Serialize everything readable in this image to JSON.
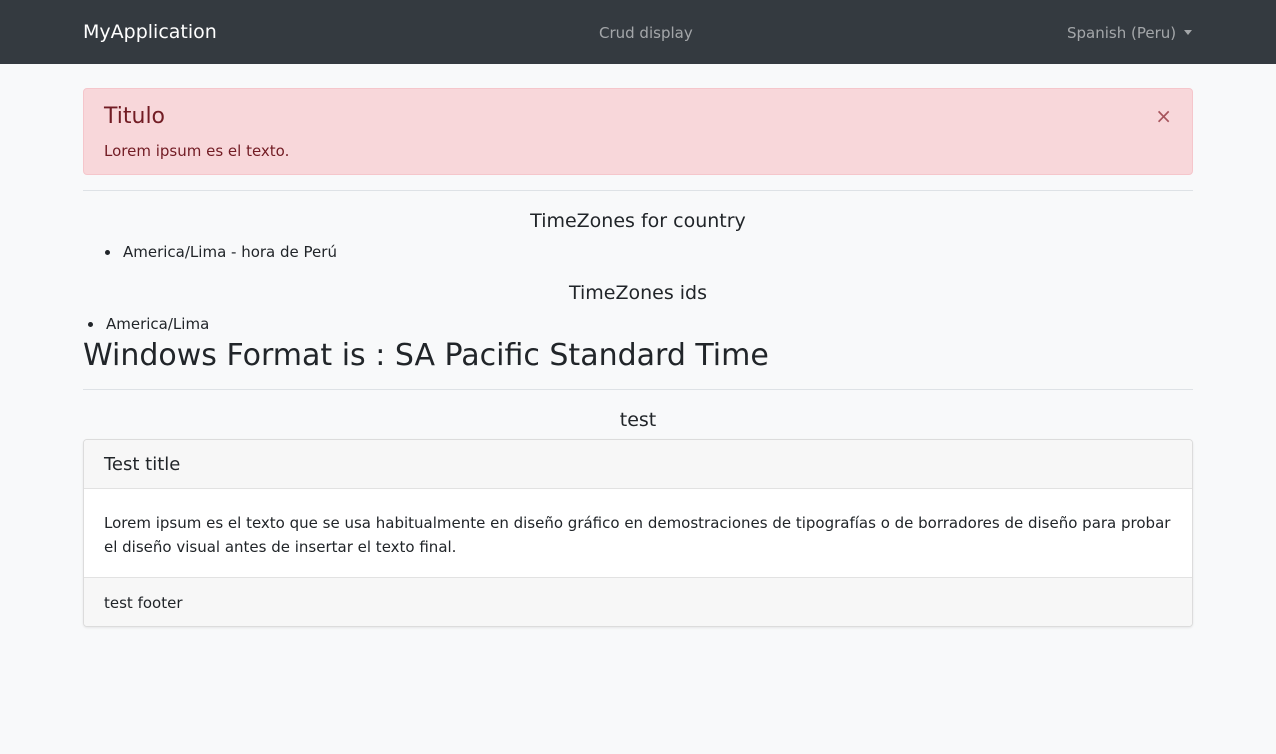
{
  "navbar": {
    "brand": "MyApplication",
    "link": "Crud display",
    "language": "Spanish (Peru)"
  },
  "alert": {
    "title": "Titulo",
    "text": "Lorem ipsum es el texto.",
    "close": "×"
  },
  "timezones_country": {
    "title": "TimeZones for country",
    "items": [
      "America/Lima - hora de Perú"
    ]
  },
  "timezones_ids": {
    "title": "TimeZones ids",
    "items": [
      "America/Lima"
    ]
  },
  "windows_format": "Windows Format is : SA Pacific Standard Time",
  "test_section": {
    "title": "test"
  },
  "card": {
    "header": "Test title",
    "body": "Lorem ipsum es el texto que se usa habitualmente en diseño gráfico en demostraciones de tipografías o de borradores de diseño para probar el diseño visual antes de insertar el texto final.",
    "footer": "test footer"
  },
  "colors": {
    "navbar_bg": "#343a40",
    "page_bg": "#f8f9fa",
    "alert_bg": "#f8d7da",
    "alert_text": "#721c24"
  }
}
